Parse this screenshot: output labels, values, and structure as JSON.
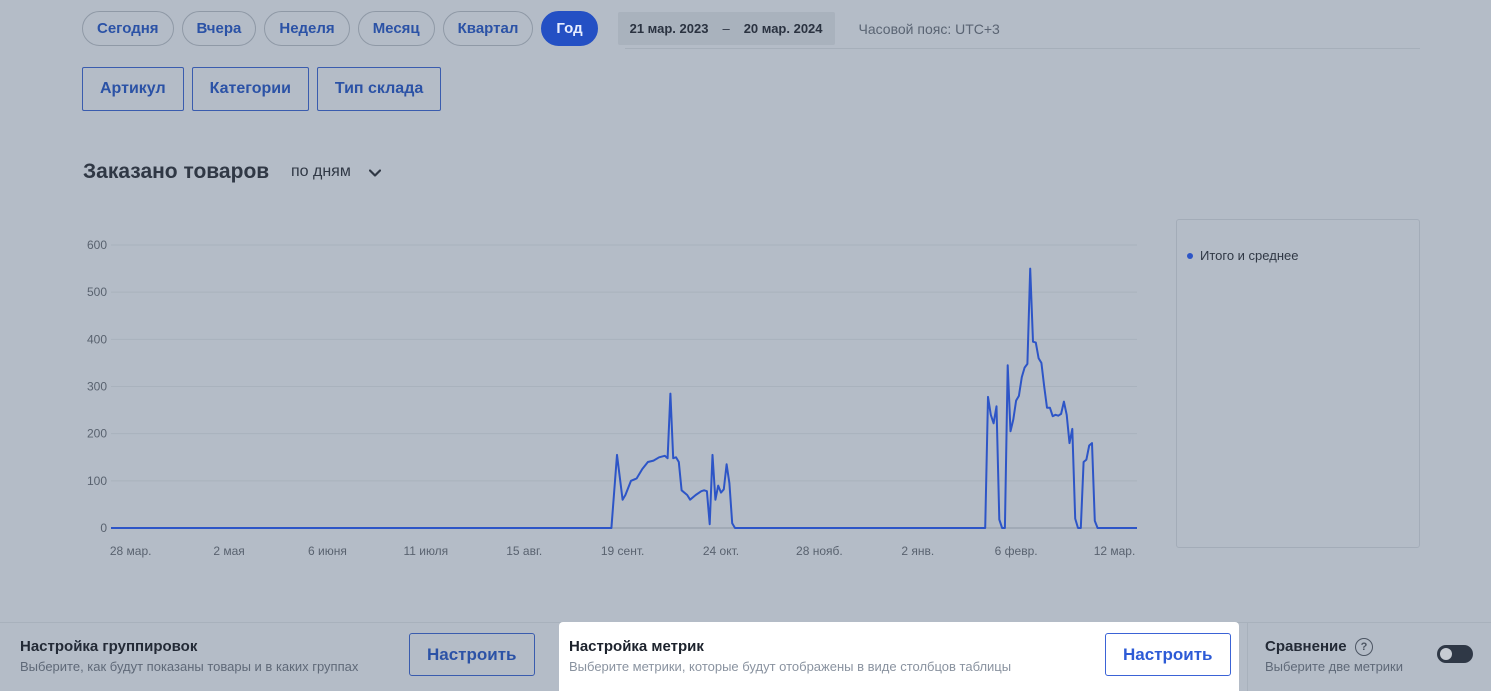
{
  "periods": {
    "tabs": [
      {
        "label": "Сегодня",
        "active": false
      },
      {
        "label": "Вчера",
        "active": false
      },
      {
        "label": "Неделя",
        "active": false
      },
      {
        "label": "Месяц",
        "active": false
      },
      {
        "label": "Квартал",
        "active": false
      },
      {
        "label": "Год",
        "active": true
      }
    ],
    "date_from": "21 мар. 2023",
    "date_sep": "–",
    "date_to": "20 мар. 2024",
    "timezone": "Часовой пояс: UTC+3"
  },
  "grouping_buttons": [
    "Артикул",
    "Категории",
    "Тип склада"
  ],
  "chart_header": {
    "title": "Заказано товаров",
    "aggregation": "по дням",
    "chevron_icon": "chevron-down-icon"
  },
  "legend": {
    "items": [
      {
        "label": "Итого и среднее",
        "color": "#2d55c7"
      }
    ]
  },
  "bottom": {
    "grouping": {
      "title": "Настройка группировок",
      "subtitle": "Выберите, как будут показаны товары и в каких группах",
      "button": "Настроить"
    },
    "metrics": {
      "title": "Настройка метрик",
      "subtitle": "Выберите метрики, которые будут отображены в виде столбцов таблицы",
      "button": "Настроить"
    },
    "comparison": {
      "title": "Сравнение",
      "subtitle": "Выберите две метрики",
      "help_icon": "question-circle-icon",
      "toggle_on": false
    }
  },
  "chart_data": {
    "type": "line",
    "title": "",
    "xlabel": "",
    "ylabel": "",
    "ylim": [
      0,
      600
    ],
    "yticks": [
      0,
      100,
      200,
      300,
      400,
      500,
      600
    ],
    "grid": true,
    "legend_position": "right",
    "line_color": "#2d55c7",
    "xtick_labels": [
      {
        "label": "28 мар.",
        "day": 7
      },
      {
        "label": "2 мая",
        "day": 42
      },
      {
        "label": "6 июня",
        "day": 77
      },
      {
        "label": "11 июля",
        "day": 112
      },
      {
        "label": "15 авг.",
        "day": 147
      },
      {
        "label": "19 сент.",
        "day": 182
      },
      {
        "label": "24 окт.",
        "day": 217
      },
      {
        "label": "28 нояб.",
        "day": 252
      },
      {
        "label": "2 янв.",
        "day": 287
      },
      {
        "label": "6 февр.",
        "day": 322
      },
      {
        "label": "12 мар.",
        "day": 357
      }
    ],
    "x_domain": [
      0,
      365
    ],
    "series": [
      {
        "points": [
          [
            0,
            0
          ],
          [
            178,
            0
          ],
          [
            180,
            155
          ],
          [
            182,
            60
          ],
          [
            183,
            70
          ],
          [
            185,
            100
          ],
          [
            187,
            105
          ],
          [
            189,
            125
          ],
          [
            191,
            140
          ],
          [
            193,
            143
          ],
          [
            195,
            150
          ],
          [
            197,
            153
          ],
          [
            198,
            148
          ],
          [
            199,
            285
          ],
          [
            200,
            148
          ],
          [
            201,
            150
          ],
          [
            202,
            140
          ],
          [
            203,
            80
          ],
          [
            205,
            70
          ],
          [
            206,
            60
          ],
          [
            208,
            70
          ],
          [
            210,
            78
          ],
          [
            211,
            80
          ],
          [
            212,
            78
          ],
          [
            213,
            8
          ],
          [
            214,
            155
          ],
          [
            215,
            60
          ],
          [
            216,
            90
          ],
          [
            217,
            75
          ],
          [
            218,
            82
          ],
          [
            219,
            135
          ],
          [
            220,
            95
          ],
          [
            221,
            10
          ],
          [
            222,
            0
          ],
          [
            311,
            0
          ],
          [
            312,
            278
          ],
          [
            313,
            240
          ],
          [
            314,
            222
          ],
          [
            315,
            258
          ],
          [
            316,
            18
          ],
          [
            317,
            0
          ],
          [
            318,
            0
          ],
          [
            319,
            345
          ],
          [
            320,
            205
          ],
          [
            321,
            230
          ],
          [
            322,
            270
          ],
          [
            323,
            280
          ],
          [
            324,
            320
          ],
          [
            325,
            340
          ],
          [
            326,
            348
          ],
          [
            327,
            550
          ],
          [
            328,
            395
          ],
          [
            329,
            393
          ],
          [
            330,
            360
          ],
          [
            331,
            350
          ],
          [
            332,
            300
          ],
          [
            333,
            255
          ],
          [
            334,
            255
          ],
          [
            335,
            237
          ],
          [
            336,
            240
          ],
          [
            337,
            238
          ],
          [
            338,
            242
          ],
          [
            339,
            268
          ],
          [
            340,
            240
          ],
          [
            341,
            180
          ],
          [
            342,
            210
          ],
          [
            343,
            20
          ],
          [
            344,
            0
          ],
          [
            345,
            0
          ],
          [
            346,
            140
          ],
          [
            347,
            145
          ],
          [
            348,
            175
          ],
          [
            349,
            180
          ],
          [
            350,
            15
          ],
          [
            351,
            0
          ],
          [
            365,
            0
          ]
        ]
      }
    ]
  }
}
